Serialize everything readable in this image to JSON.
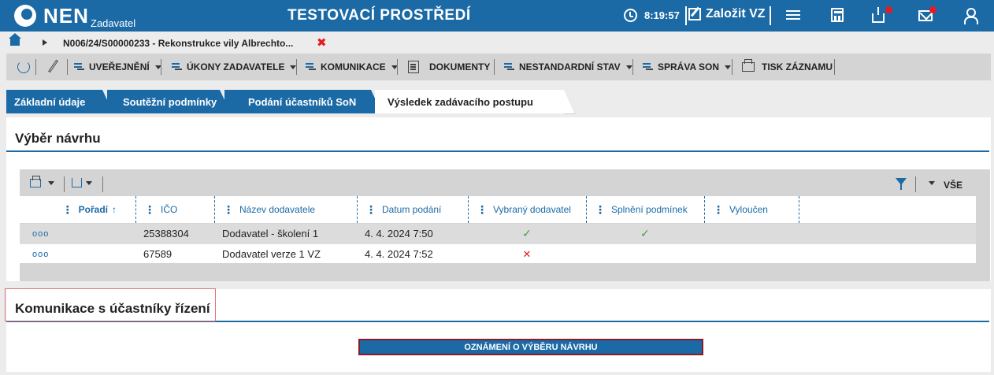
{
  "header": {
    "brand": "NEN",
    "brand_sub": "Zadavatel",
    "env_title": "TESTOVACÍ PROSTŘEDÍ",
    "clock": "8:19:57",
    "create_label": "Založit VZ"
  },
  "breadcrumb": {
    "text": "N006/24/S00000233 - Rekonstrukce vily Albrechto...",
    "close": "✖"
  },
  "toolbar": {
    "uverejneni": "UVEŘEJNĚNÍ",
    "ukony": "ÚKONY ZADAVATELE",
    "komunikace": "KOMUNIKACE",
    "dokumenty": "DOKUMENTY",
    "nestandardni": "NESTANDARDNÍ STAV",
    "sprava": "SPRÁVA SON",
    "tisk": "TISK ZÁZNAMU"
  },
  "tabs": [
    {
      "label": "Základní údaje"
    },
    {
      "label": "Soutěžní podmínky"
    },
    {
      "label": "Podání účastníků SoN"
    },
    {
      "label": "Výsledek zadávacího postupu"
    }
  ],
  "selection": {
    "title": "Výběr návrhu",
    "filter_all": "VŠE",
    "columns": {
      "poradi": "Pořadí",
      "sort": "↑",
      "ico": "IČO",
      "nazev": "Název dodavatele",
      "datum": "Datum podání",
      "vybrany": "Vybraný dodavatel",
      "splneni": "Splnění podmínek",
      "vyloucen": "Vyloučen"
    },
    "rows": [
      {
        "menu": "ooo",
        "ico": "25388304",
        "nazev": "Dodavatel - školení 1",
        "datum": "4. 4. 2024 7:50",
        "vybrany": "✓",
        "splneni": "✓"
      },
      {
        "menu": "ooo",
        "ico": "67589",
        "nazev": "Dodavatel verze 1 VZ",
        "datum": "4. 4. 2024 7:52",
        "vybrany": "✕",
        "splneni": ""
      }
    ]
  },
  "communication": {
    "title": "Komunikace s účastníky řízení",
    "button": "OZNÁMENÍ O VÝBĚRU NÁVRHU"
  }
}
